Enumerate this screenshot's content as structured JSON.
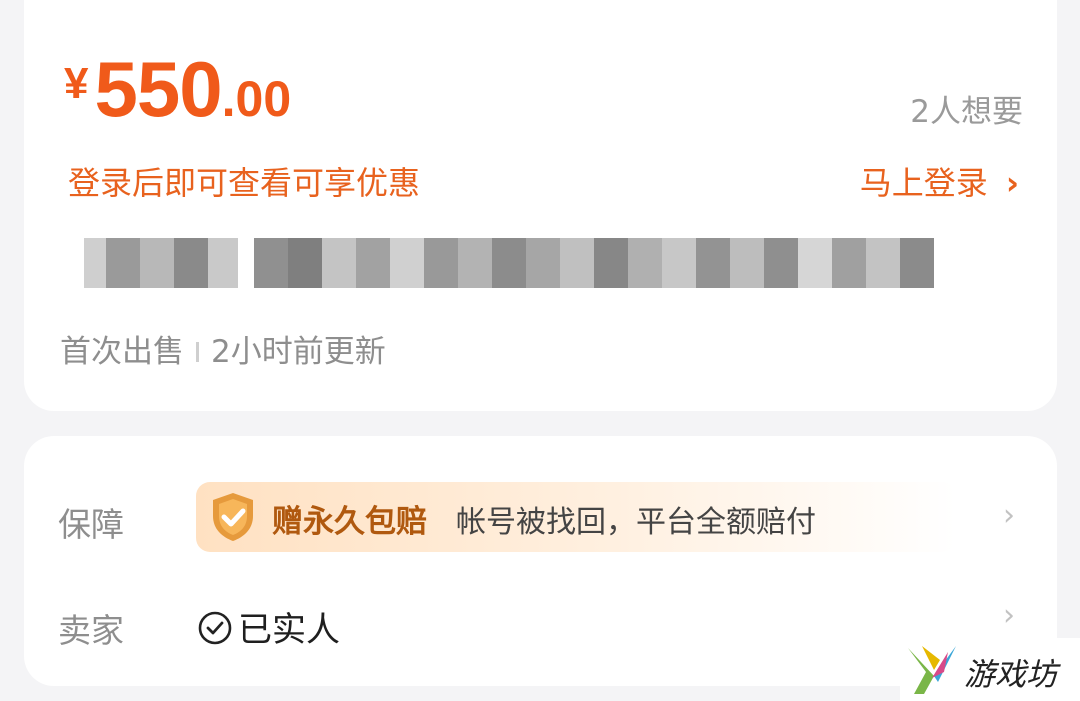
{
  "product": {
    "price": {
      "currency": "¥",
      "integer": "550",
      "decimal": ".00"
    },
    "want_count": "2人想要",
    "login_tip": "登录后即可查看可享优惠",
    "login_link": "马上登录",
    "login_chevron": "›",
    "meta": {
      "first_sale": "首次出售",
      "updated": "2小时前更新"
    }
  },
  "service": {
    "guarantee": {
      "label": "保障",
      "title": "赠永久包赔",
      "description": "帐号被找回，平台全额赔付"
    },
    "seller": {
      "label": "卖家",
      "status": "已实人"
    },
    "chevron": "›"
  },
  "watermark": {
    "text": "游戏坊"
  },
  "colors": {
    "accent": "#f05a1a",
    "guarantee_text": "#b0590f",
    "muted": "#8e8e8e",
    "background": "#f4f4f6"
  },
  "icons": [
    "shield-check-icon",
    "check-circle-icon",
    "chevron-right-icon",
    "watermark-logo"
  ]
}
